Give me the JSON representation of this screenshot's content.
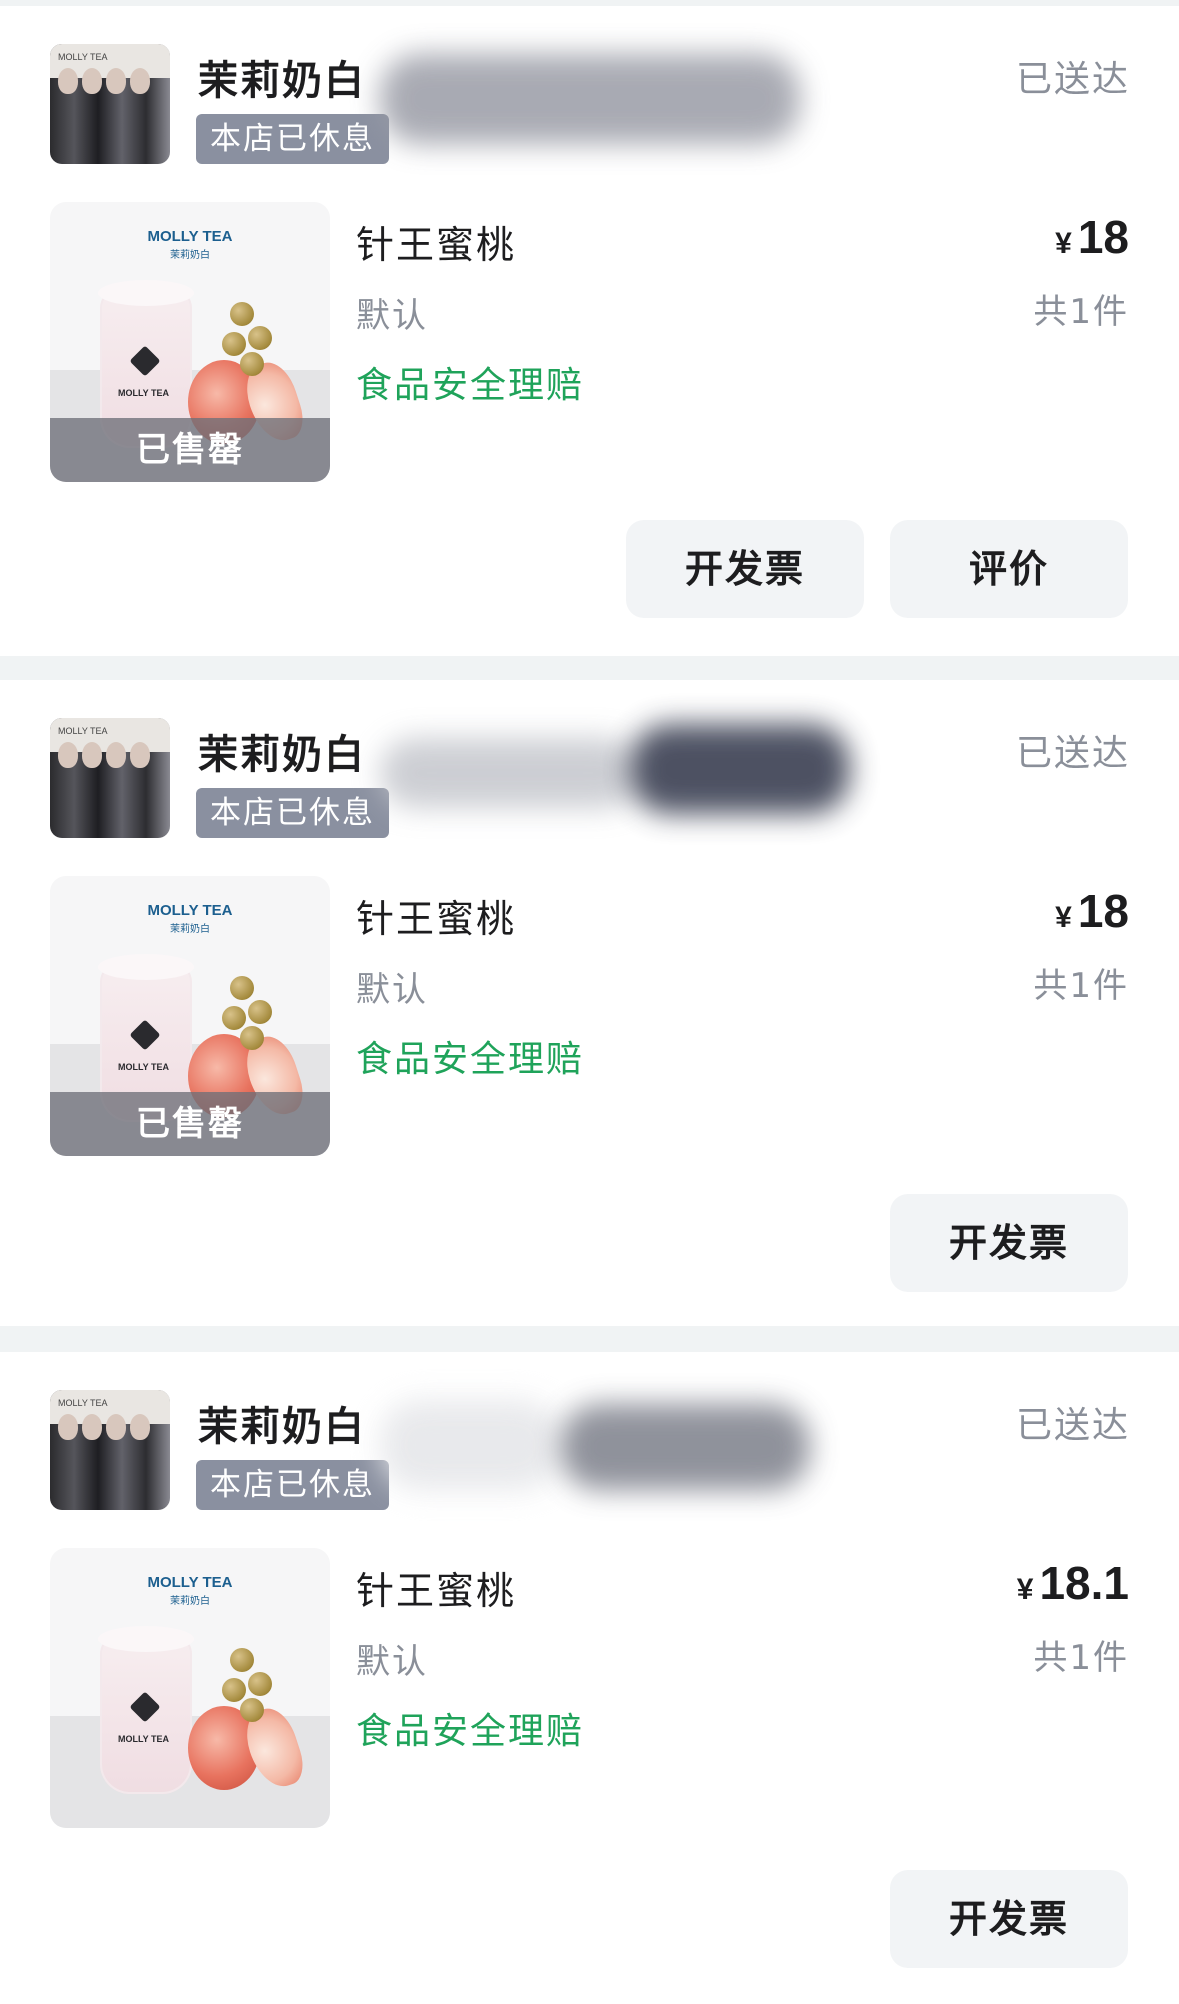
{
  "orders": [
    {
      "store_name": "茉莉奶白",
      "store_badge": "本店已休息",
      "status": "已送达",
      "product": {
        "brand": "MOLLY TEA",
        "brand_sub": "茉莉奶白",
        "cup_text": "MOLLY TEA",
        "name": "针王蜜桃",
        "spec": "默认",
        "claim": "食品安全理赔",
        "soldout": "已售罄",
        "price_symbol": "¥",
        "price": "18",
        "count": "共1件"
      },
      "buttons": [
        "开发票",
        "评价"
      ]
    },
    {
      "store_name": "茉莉奶白",
      "store_badge": "本店已休息",
      "status": "已送达",
      "product": {
        "brand": "MOLLY TEA",
        "brand_sub": "茉莉奶白",
        "cup_text": "MOLLY TEA",
        "name": "针王蜜桃",
        "spec": "默认",
        "claim": "食品安全理赔",
        "soldout": "已售罄",
        "price_symbol": "¥",
        "price": "18",
        "count": "共1件"
      },
      "buttons": [
        "开发票"
      ]
    },
    {
      "store_name": "茉莉奶白",
      "store_badge": "本店已休息",
      "status": "已送达",
      "product": {
        "brand": "MOLLY TEA",
        "brand_sub": "茉莉奶白",
        "cup_text": "MOLLY TEA",
        "name": "针王蜜桃",
        "spec": "默认",
        "claim": "食品安全理赔",
        "price_symbol": "¥",
        "price": "18.1",
        "count": "共1件"
      },
      "buttons": [
        "开发票"
      ]
    }
  ]
}
